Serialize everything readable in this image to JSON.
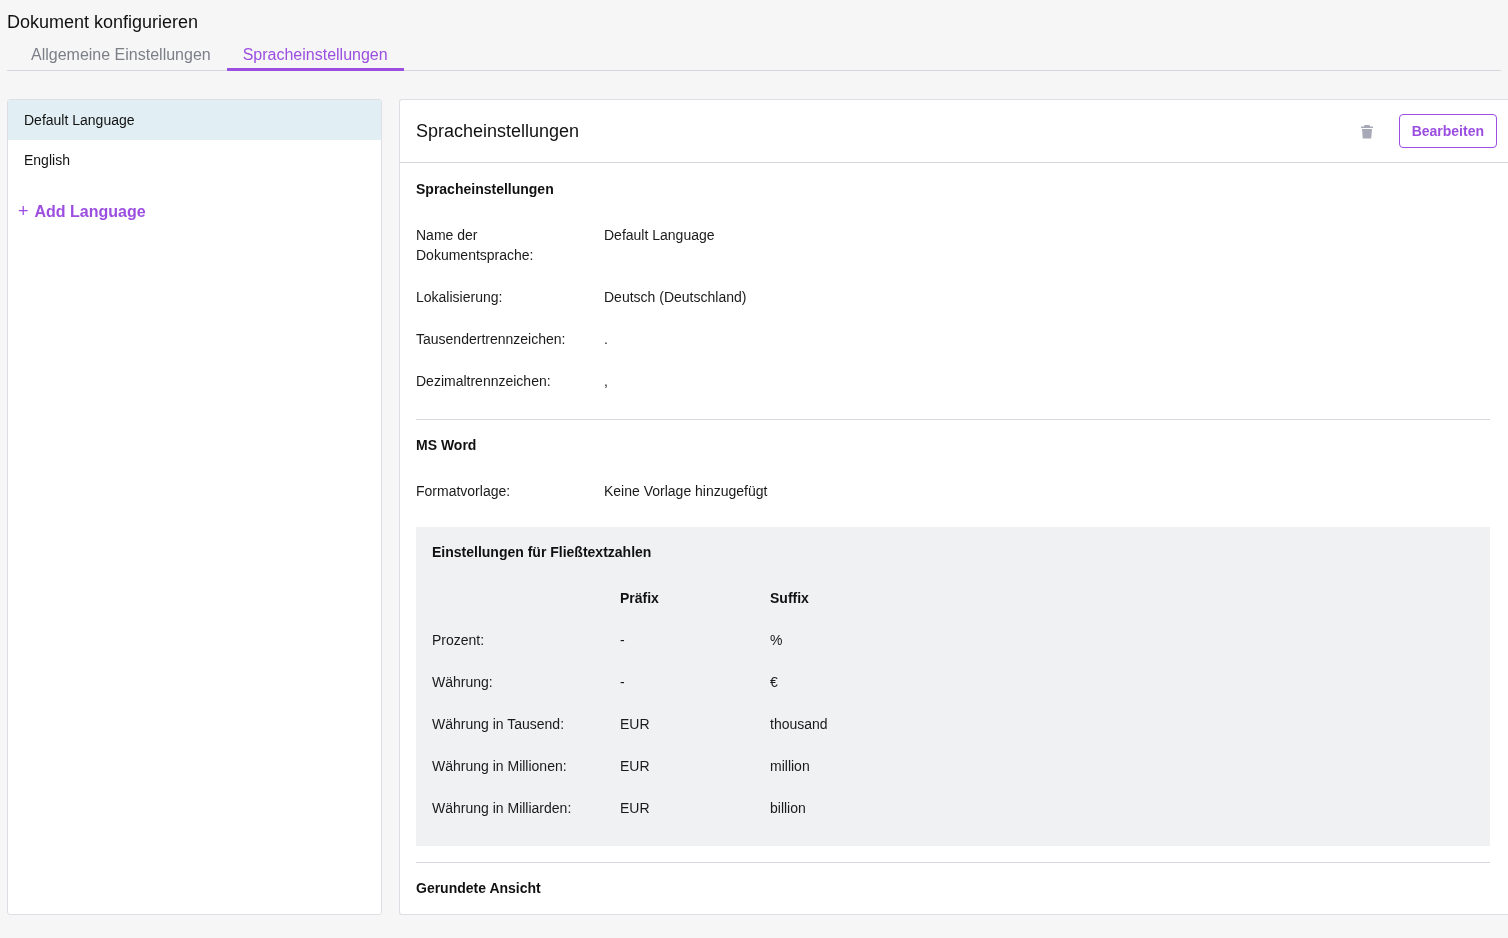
{
  "page_title": "Dokument konfigurieren",
  "tabs": [
    {
      "label": "Allgemeine Einstellungen",
      "selected": false
    },
    {
      "label": "Spracheinstellungen",
      "selected": true
    }
  ],
  "languages": [
    {
      "name": "Default Language",
      "selected": true
    },
    {
      "name": "English",
      "selected": false
    }
  ],
  "add_language": {
    "icon": "+",
    "label": "Add Language"
  },
  "detail": {
    "title": "Spracheinstellungen",
    "edit_button": "Bearbeiten",
    "language_section": {
      "heading": "Spracheinstellungen",
      "fields": [
        {
          "label": "Name der Dokumentsprache:",
          "value": "Default Language"
        },
        {
          "label": "Lokalisierung:",
          "value": "Deutsch (Deutschland)"
        },
        {
          "label": "Tausendertrennzeichen:",
          "value": "."
        },
        {
          "label": "Dezimaltrennzeichen:",
          "value": ","
        }
      ]
    },
    "word_section": {
      "heading": "MS Word",
      "fields": [
        {
          "label": "Formatvorlage:",
          "value": "Keine Vorlage hinzugefügt"
        }
      ]
    },
    "numbers": {
      "heading": "Einstellungen für Fließtextzahlen",
      "columns": [
        "Präfix",
        "Suffix"
      ],
      "rows": [
        {
          "label": "Prozent:",
          "prefix": "-",
          "suffix": "%"
        },
        {
          "label": "Währung:",
          "prefix": "-",
          "suffix": "€"
        },
        {
          "label": "Währung in Tausend:",
          "prefix": "EUR",
          "suffix": "thousand"
        },
        {
          "label": "Währung in Millionen:",
          "prefix": "EUR",
          "suffix": "million"
        },
        {
          "label": "Währung in Milliarden:",
          "prefix": "EUR",
          "suffix": "billion"
        }
      ]
    },
    "rounded_heading": "Gerundete Ansicht"
  }
}
